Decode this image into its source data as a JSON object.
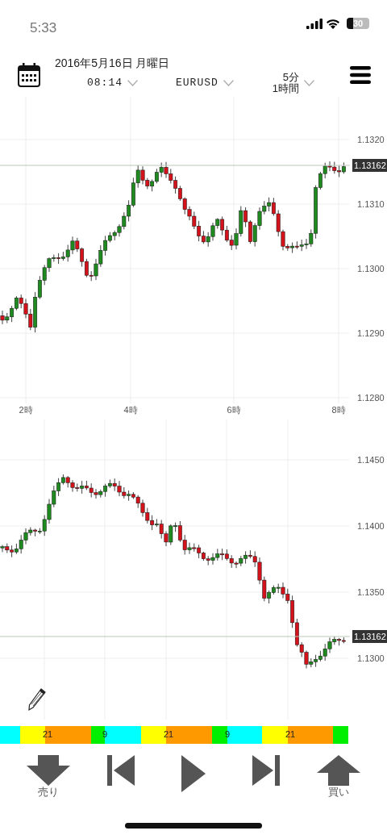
{
  "status_bar": {
    "time": "5:33",
    "battery": "30"
  },
  "header": {
    "date": "2016年5月16日 月曜日",
    "time": "08:14",
    "symbol": "EURUSD",
    "timeframes": [
      "5分",
      "1時間"
    ]
  },
  "charts": [
    {
      "y_labels": [
        "1.1320",
        "1.1310",
        "1.1300",
        "1.1290",
        "1.1280"
      ],
      "x_labels": [
        "2時",
        "4時",
        "6時",
        "8時"
      ],
      "current_price": "1.13162"
    },
    {
      "y_labels": [
        "1.1450",
        "1.1400",
        "1.1350",
        "1.1300"
      ],
      "current_price": "1.13162"
    }
  ],
  "cycle_strip": [
    {
      "color": "#00ffff"
    },
    {
      "color": "#ffff00"
    },
    {
      "color": "#ff9900",
      "label": "21"
    },
    {
      "color": "#00ee00"
    },
    {
      "color": "#00ffff",
      "label": "9"
    },
    {
      "color": "#ffff00"
    },
    {
      "color": "#ff9900",
      "label": "21"
    },
    {
      "color": "#00ee00"
    },
    {
      "color": "#00ffff",
      "label": "9"
    },
    {
      "color": "#ffff00"
    },
    {
      "color": "#ff9900",
      "label": "21"
    },
    {
      "color": "#00ee00"
    }
  ],
  "controls": [
    {
      "kind": "sell",
      "label": "売り"
    },
    {
      "kind": "back"
    },
    {
      "kind": "play"
    },
    {
      "kind": "forward"
    },
    {
      "kind": "buy",
      "label": "買い"
    }
  ]
}
